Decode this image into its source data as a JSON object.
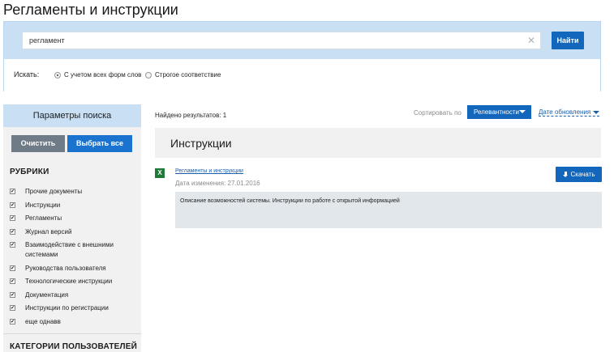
{
  "page": {
    "title": "Регламенты и инструкции"
  },
  "search": {
    "value": "регламент",
    "clear_icon": "close-icon",
    "button_label": "Найти",
    "search_for_label": "Искать:",
    "options": [
      {
        "label": "С учетом всех форм слов",
        "selected": true
      },
      {
        "label": "Строгое соответствие",
        "selected": false
      }
    ]
  },
  "sidebar": {
    "header": "Параметры поиска",
    "clear_label": "Очистить",
    "select_all_label": "Выбрать все",
    "rubrics_title": "РУБРИКИ",
    "rubrics": [
      {
        "label": "Прочие документы",
        "checked": true
      },
      {
        "label": "Инструкции",
        "checked": true
      },
      {
        "label": "Регламенты",
        "checked": true
      },
      {
        "label": "Журнал версий",
        "checked": true
      },
      {
        "label": "Взаимодействие с внешними системами",
        "checked": true
      },
      {
        "label": "Руководства пользователя",
        "checked": true
      },
      {
        "label": "Технологические инструкции",
        "checked": true
      },
      {
        "label": "Документация",
        "checked": true
      },
      {
        "label": "Инструкции по регистрации",
        "checked": true
      },
      {
        "label": "еще однавв",
        "checked": true
      }
    ],
    "user_categories_title": "КАТЕГОРИИ ПОЛЬЗОВАТЕЛЕЙ"
  },
  "results": {
    "count_text": "Найдено результатов: 1",
    "sort_label": "Сортировать по",
    "sort_relevance": "Релевантности",
    "sort_date": "Дате обновления",
    "category_title": "Инструкции",
    "items": [
      {
        "file_icon": "excel-icon",
        "file_icon_text": "X",
        "link": "Регламенты и инструкции",
        "date": "Дата изменения: 27.01.2016",
        "download_label": "Скачать",
        "description": "Описание возможностей системы. Инструкции по работе с открытой информацией"
      }
    ]
  },
  "colors": {
    "accent": "#1266bb",
    "panel": "#c8dff4",
    "excel": "#1f7a3a"
  }
}
